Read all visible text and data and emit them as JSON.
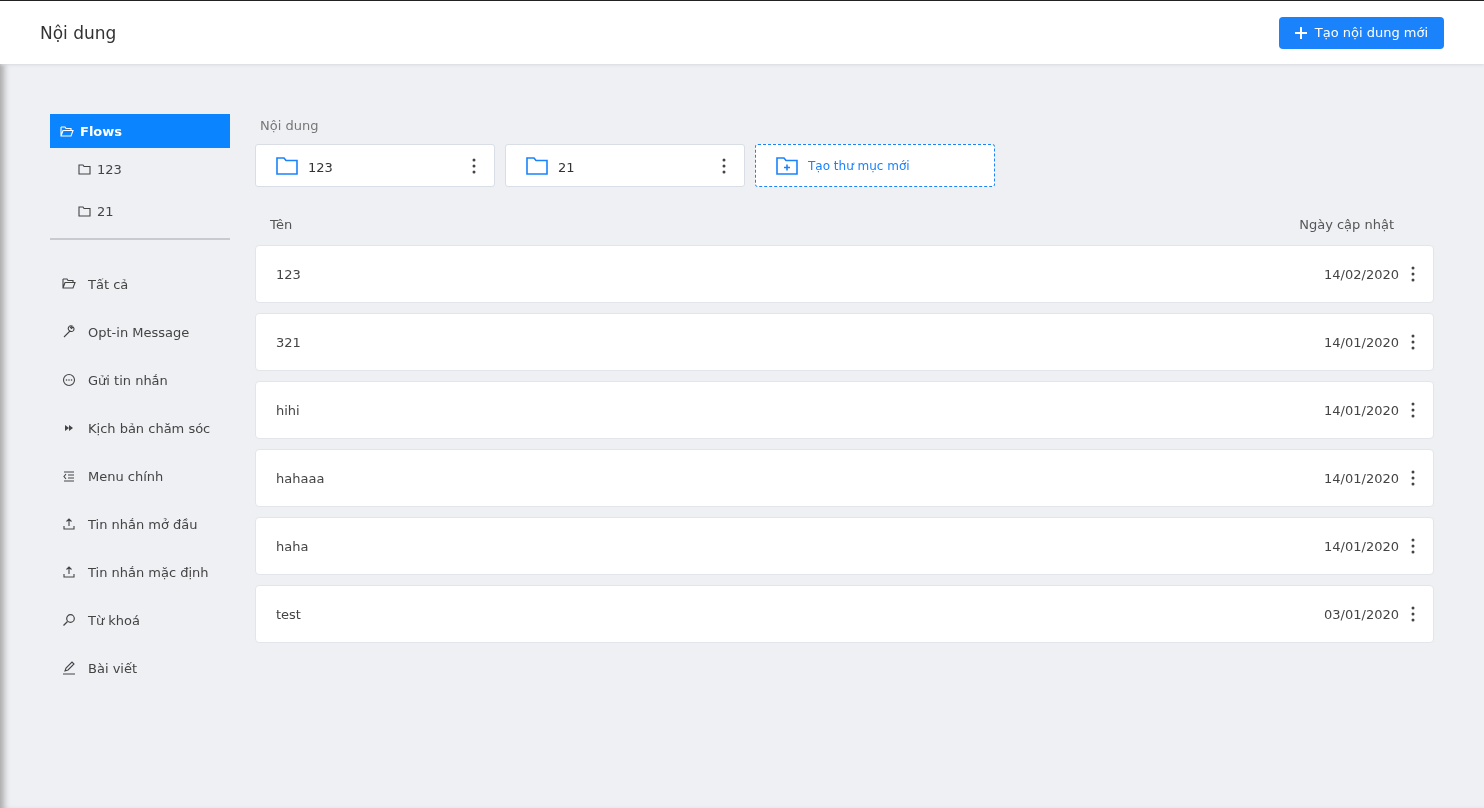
{
  "header": {
    "title": "Nội dung",
    "create_button": "Tạo nội dung mới"
  },
  "folder_tree": {
    "label": "Flows",
    "selected": true,
    "children": [
      {
        "label": "123",
        "selected": false
      },
      {
        "label": "21",
        "selected": false
      }
    ]
  },
  "sidebar": {
    "items": [
      {
        "label": "Tất cả",
        "selected": false
      },
      {
        "label": "Opt-in Message",
        "selected": false
      },
      {
        "label": "Gửi tin nhắn",
        "selected": false
      },
      {
        "label": "Kịch bản chăm sóc",
        "selected": false
      },
      {
        "label": "Menu chính",
        "selected": false
      },
      {
        "label": "Tin nhắn mở đầu",
        "selected": false
      },
      {
        "label": "Tin nhắn mặc định",
        "selected": false
      },
      {
        "label": "Từ khoá",
        "selected": false
      },
      {
        "label": "Bài viết",
        "selected": false
      }
    ]
  },
  "breadcrumb": "Nội dung",
  "folders": [
    {
      "name": "123"
    },
    {
      "name": "21"
    }
  ],
  "new_folder": "Tạo thư mục mới",
  "table": {
    "columns": [
      "Tên",
      "Ngày cập nhật"
    ],
    "rows": [
      {
        "name": "123",
        "updated": "14/02/2020"
      },
      {
        "name": "321",
        "updated": "14/01/2020"
      },
      {
        "name": "hihi",
        "updated": "14/01/2020"
      },
      {
        "name": "hahaaa",
        "updated": "14/01/2020"
      },
      {
        "name": "haha",
        "updated": "14/01/2020"
      },
      {
        "name": "test",
        "updated": "03/01/2020"
      }
    ]
  }
}
